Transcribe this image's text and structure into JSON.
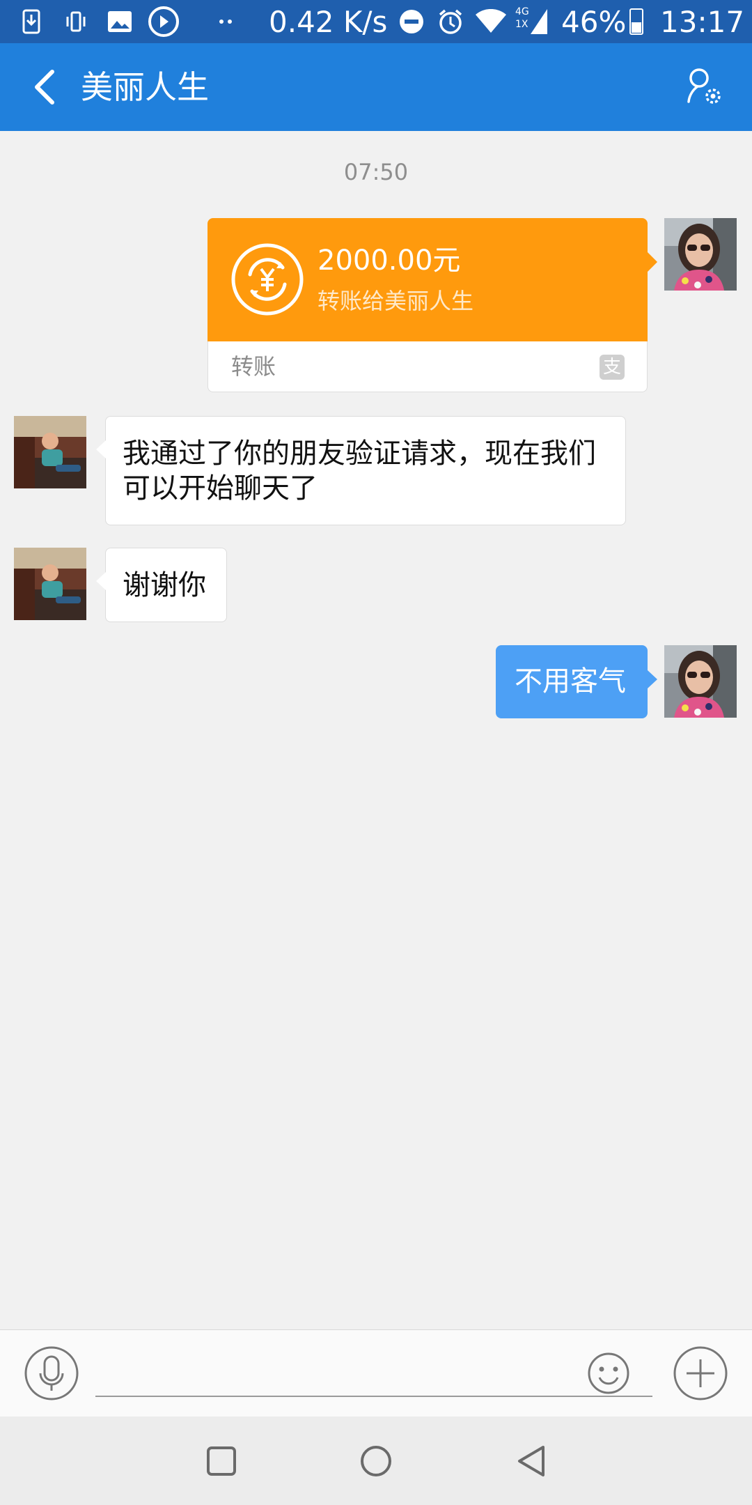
{
  "status_bar": {
    "network_speed": "0.42 K/s",
    "network_type": "4G",
    "network_sub": "1X",
    "battery_percent": "46%",
    "battery_level": 0.46,
    "time": "13:17",
    "icons": [
      "download-icon",
      "vibrate-icon",
      "image-icon",
      "play-icon",
      "more-dots-icon",
      "dnd-icon",
      "alarm-icon",
      "wifi-icon",
      "signal-icon",
      "battery-icon"
    ]
  },
  "header": {
    "title": "美丽人生",
    "back_icon": "back-arrow-icon",
    "settings_icon": "contact-settings-icon",
    "color": "#2080dc"
  },
  "chat": {
    "timestamp": "07:50",
    "messages": [
      {
        "type": "transfer",
        "side": "right",
        "amount": "2000.00元",
        "description": "转账给美丽人生",
        "label": "转账",
        "brand_icon": "alipay-icon",
        "color": "#ff9a0d"
      },
      {
        "type": "text",
        "side": "left",
        "text": "我通过了你的朋友验证请求，现在我们可以开始聊天了"
      },
      {
        "type": "text",
        "side": "left",
        "text": "谢谢你"
      },
      {
        "type": "text",
        "side": "right",
        "text": "不用客气",
        "color": "#4da0f5"
      }
    ]
  },
  "input_bar": {
    "value": "",
    "icons": [
      "voice-icon",
      "emoji-icon",
      "plus-icon"
    ]
  },
  "nav_bar": {
    "icons": [
      "recents-icon",
      "home-icon",
      "back-icon"
    ]
  }
}
